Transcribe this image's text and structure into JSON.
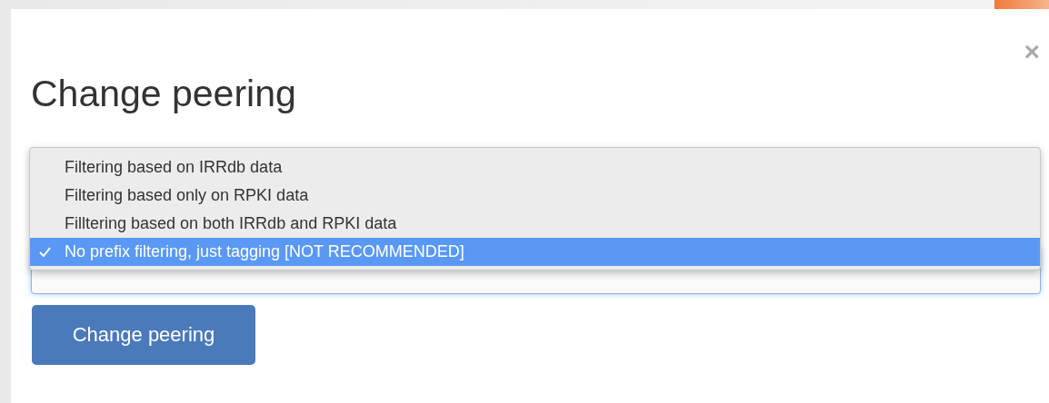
{
  "dialog": {
    "title": "Change peering",
    "close": "×"
  },
  "filter_select": {
    "options": [
      {
        "label": "Filtering based on IRRdb data",
        "selected": false
      },
      {
        "label": "Filtering based only on RPKI data",
        "selected": false
      },
      {
        "label": "Filltering based on both IRRdb and RPKI data",
        "selected": false
      },
      {
        "label": "No prefix filtering, just tagging [NOT RECOMMENDED]",
        "selected": true
      }
    ]
  },
  "submit_button": "Change peering"
}
